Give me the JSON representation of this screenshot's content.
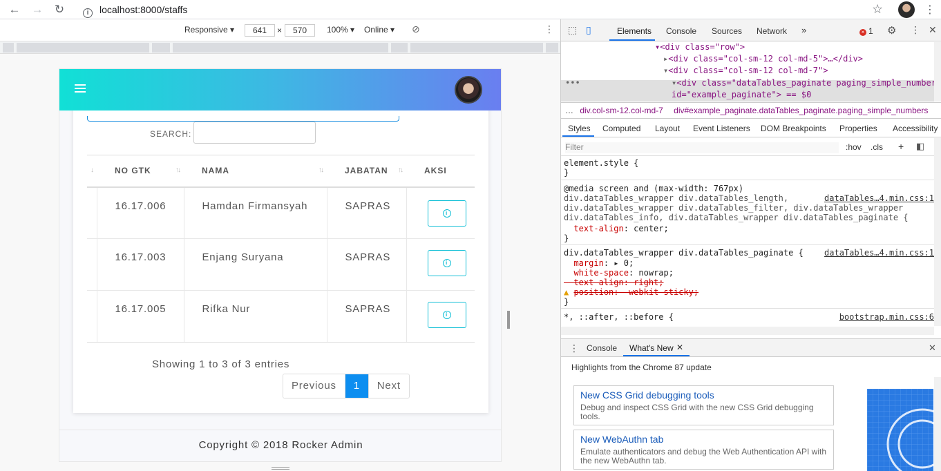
{
  "browser": {
    "url": "localhost:8000/staffs"
  },
  "device_toolbar": {
    "mode": "Responsive",
    "width": "641",
    "times": "×",
    "height": "570",
    "zoom": "100%",
    "network": "Online"
  },
  "app": {
    "search_label": "SEARCH:",
    "table": {
      "columns": [
        "NO GTK",
        "NAMA",
        "JABATAN",
        "AKSI"
      ],
      "rows": [
        {
          "no_gtk": "16.17.006",
          "nama": "Hamdan Firmansyah",
          "jabatan": "SAPRAS"
        },
        {
          "no_gtk": "16.17.003",
          "nama": "Enjang Suryana",
          "jabatan": "SAPRAS"
        },
        {
          "no_gtk": "16.17.005",
          "nama": "Rifka Nur",
          "jabatan": "SAPRAS"
        }
      ]
    },
    "showing": "Showing 1 to 3 of 3 entries",
    "pagination": {
      "previous": "Previous",
      "current": "1",
      "next": "Next"
    },
    "footer": "Copyright © 2018 Rocker Admin",
    "colors": {
      "header_start": "#11e0d6",
      "header_end": "#6a7ef0",
      "accent": "#0d8ef0",
      "info": "#11bfd6"
    }
  },
  "devtools": {
    "tabs": [
      "Elements",
      "Console",
      "Sources",
      "Network"
    ],
    "error_count": "1",
    "dom": {
      "line1_tag": "<div class=\"row\">",
      "line2_tag": "<div class=\"col-sm-12 col-md-5\">…</div>",
      "line3_tag": "<div class=\"col-sm-12 col-md-7\">",
      "line4_tag": "<div class=\"dataTables_paginate paging_simple_numbers\"",
      "line5_tag": "id=\"example_paginate\"> == $0"
    },
    "breadcrumbs": {
      "first": "div.col-sm-12.col-md-7",
      "second": "div#example_paginate.dataTables_paginate.paging_simple_numbers"
    },
    "styles_tabs": [
      "Styles",
      "Computed",
      "Layout",
      "Event Listeners",
      "DOM Breakpoints",
      "Properties",
      "Accessibility"
    ],
    "filter_placeholder": "Filter",
    "hov": ":hov",
    "cls": ".cls",
    "rules": {
      "element_style": "element.style {",
      "media": "@media screen and (max-width: 767px)",
      "media_sel1": "div.dataTables_wrapper div.dataTables_length,",
      "media_sel2": "div.dataTables_wrapper div.dataTables_filter, div.dataTables_wrapper",
      "media_sel3": "div.dataTables_info, div.dataTables_wrapper div.dataTables_paginate {",
      "media_src": "dataTables…4.min.css:1",
      "text_align_center": "center;",
      "paginate_sel": "div.dataTables_wrapper div.dataTables_paginate {",
      "paginate_src": "dataTables…4.min.css:1",
      "margin": "▸ 0;",
      "white_space": "nowrap;",
      "text_align_right": "text-align: right;",
      "position": "position: -webkit-sticky;",
      "universal": "*, ::after, ::before {",
      "universal_src": "bootstrap.min.css:6"
    },
    "drawer": {
      "tabs": [
        "Console",
        "What's New"
      ],
      "highlights": "Highlights from the Chrome 87 update",
      "items": [
        {
          "title": "New CSS Grid debugging tools",
          "desc": "Debug and inspect CSS Grid with the new CSS Grid debugging tools."
        },
        {
          "title": "New WebAuthn tab",
          "desc": "Emulate authenticators and debug the Web Authentication API with the new WebAuthn tab."
        }
      ]
    }
  }
}
